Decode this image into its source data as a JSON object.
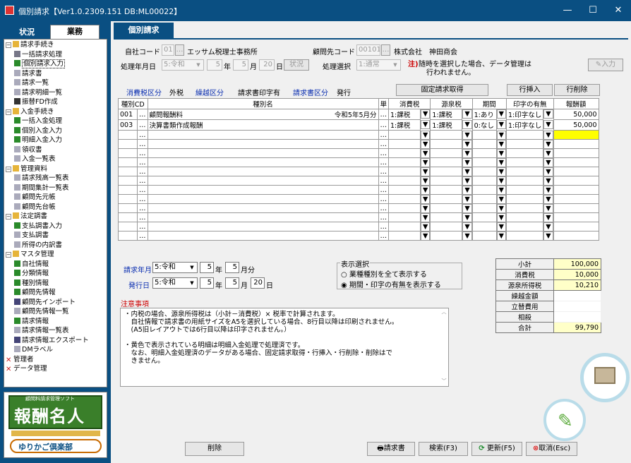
{
  "window": {
    "title": "個別請求【Ver1.0.2309.151 DB:ML00022】",
    "minimize": "—",
    "maximize": "☐",
    "close": "✕"
  },
  "sidebar": {
    "tab_status": "状況",
    "tab_business": "業務",
    "tree": [
      {
        "label": "請求手続き",
        "level": 0,
        "box": "−",
        "icon": "folder"
      },
      {
        "label": "一括請求処理",
        "level": 1,
        "icon": "list"
      },
      {
        "label": "個別請求入力",
        "level": 1,
        "icon": "pen",
        "selected": true
      },
      {
        "label": "請求書",
        "level": 1,
        "icon": "doc"
      },
      {
        "label": "請求一覧",
        "level": 1,
        "icon": "doc"
      },
      {
        "label": "請求明細一覧",
        "level": 1,
        "icon": "doc"
      },
      {
        "label": "振替FD作成",
        "level": 1,
        "icon": "disk"
      },
      {
        "label": "入金手続き",
        "level": 0,
        "box": "−",
        "icon": "folder"
      },
      {
        "label": "一括入金処理",
        "level": 1,
        "icon": "pen"
      },
      {
        "label": "個別入金入力",
        "level": 1,
        "icon": "pen"
      },
      {
        "label": "明細入金入力",
        "level": 1,
        "icon": "pen"
      },
      {
        "label": "領収書",
        "level": 1,
        "icon": "doc"
      },
      {
        "label": "入金一覧表",
        "level": 1,
        "icon": "doc"
      },
      {
        "label": "管理資料",
        "level": 0,
        "box": "−",
        "icon": "folder"
      },
      {
        "label": "請求残高一覧表",
        "level": 1,
        "icon": "doc"
      },
      {
        "label": "期間集計一覧表",
        "level": 1,
        "icon": "doc"
      },
      {
        "label": "顧問先元帳",
        "level": 1,
        "icon": "doc"
      },
      {
        "label": "顧問先台帳",
        "level": 1,
        "icon": "doc"
      },
      {
        "label": "法定調書",
        "level": 0,
        "box": "−",
        "icon": "folder"
      },
      {
        "label": "支払調書入力",
        "level": 1,
        "icon": "pen"
      },
      {
        "label": "支払調書",
        "level": 1,
        "icon": "doc"
      },
      {
        "label": "所得の内訳書",
        "level": 1,
        "icon": "doc"
      },
      {
        "label": "マスタ管理",
        "level": 0,
        "box": "−",
        "icon": "folder"
      },
      {
        "label": "自社情報",
        "level": 1,
        "icon": "pen"
      },
      {
        "label": "分類情報",
        "level": 1,
        "icon": "pen"
      },
      {
        "label": "種別情報",
        "level": 1,
        "icon": "pen"
      },
      {
        "label": "顧問先情報",
        "level": 1,
        "icon": "pen"
      },
      {
        "label": "顧問先インポート",
        "level": 1,
        "icon": "import"
      },
      {
        "label": "顧問先情報一覧",
        "level": 1,
        "icon": "doc"
      },
      {
        "label": "請求情報",
        "level": 1,
        "icon": "pen"
      },
      {
        "label": "請求情報一覧表",
        "level": 1,
        "icon": "doc"
      },
      {
        "label": "請求情報エクスポート",
        "level": 1,
        "icon": "import"
      },
      {
        "label": "DMラベル",
        "level": 1,
        "icon": "doc"
      },
      {
        "label": "管理者",
        "level": 0,
        "icon": "x"
      },
      {
        "label": "データ管理",
        "level": 0,
        "icon": "x"
      }
    ],
    "logo": {
      "small": "顧問料請求管理ソフト",
      "big": "報酬名人",
      "brand": "ゆりかご倶楽部"
    }
  },
  "main": {
    "tab": "個別請求",
    "company_label": "自社コード",
    "company_code": "01",
    "company_name": "エッサム税理士事務所",
    "client_label": "顧問先コード",
    "client_code": "00101",
    "client_name": "株式会社　神田商会",
    "date_label": "処理年月日",
    "era": "5:令和",
    "year": "5",
    "year_unit": "年",
    "month": "5",
    "month_unit": "月",
    "day": "20",
    "day_unit": "日",
    "status_btn": "状況",
    "proc_label": "処理選択",
    "proc_value": "1:通常",
    "note_mark": "注)",
    "note_text1": "随時を選択した場合、データ管理は",
    "note_text2": "行われません。",
    "input_btn": "入力",
    "tax_label": "消費税区分",
    "tax_value": "外税",
    "carry_label": "繰越区分",
    "carry_value": "請求書印字有",
    "bill_label": "請求書区分",
    "bill_value": "発行",
    "fixed_btn": "固定請求取得",
    "insert_btn": "行挿入",
    "delete_row_btn": "行削除",
    "grid": {
      "headers": [
        "種別CD",
        "種別名",
        "単",
        "消費税",
        "源泉税",
        "期間",
        "印字の有無",
        "報酬額"
      ],
      "rows": [
        {
          "cd": "001",
          "name": "顧問報酬料",
          "period": "令和5年5月分",
          "tax": "1:課税",
          "wh": "1:課税",
          "term": "1:あり",
          "print": "1:印字なし",
          "amount": "50,000"
        },
        {
          "cd": "003",
          "name": "決算書類作成報酬",
          "period": "",
          "tax": "1:課税",
          "wh": "1:課税",
          "term": "0:なし",
          "print": "1:印字なし",
          "amount": "50,000"
        }
      ],
      "empty_rows": 12
    },
    "billym_label": "請求年月",
    "bill_era": "5:令和",
    "bill_year": "5",
    "bill_month": "5",
    "bill_suffix": "月分",
    "issue_label": "発行日",
    "issue_era": "5:令和",
    "issue_year": "5",
    "issue_month": "5",
    "issue_day": "20",
    "display_title": "表示選択",
    "display_opt1": "業種種別を全て表示する",
    "display_opt2": "期間・印字の有無を表示する",
    "summary": [
      {
        "k": "小計",
        "v": "100,000"
      },
      {
        "k": "消費税",
        "v": "10,000"
      },
      {
        "k": "源泉所得税",
        "v": "10,210"
      },
      {
        "k": "繰越金額",
        "v": ""
      },
      {
        "k": "立替費用",
        "v": ""
      },
      {
        "k": "相殺",
        "v": ""
      },
      {
        "k": "合計",
        "v": "99,790"
      }
    ],
    "notes_title": "注意事項",
    "notes": [
      "・内税の場合、源泉所得税は（小計－消費税）× 税率で計算されます。",
      "　自社情報で請求書の用紙サイズをA5を選択している場合、8行目以降は印刷されません。",
      "　(A5旧レイアウトでは6行目以降は印字されません。）",
      "",
      "・黄色で表示されている明細は明細入金処理で処理済です。",
      "　なお、明細入金処理済のデータがある場合、固定請求取得・行挿入・行削除・削除はで",
      "　きません。"
    ],
    "btn_delete": "削除",
    "btn_invoice": "請求書",
    "btn_search": "検索(F3)",
    "btn_update": "更新(F5)",
    "btn_cancel": "取消(Esc)"
  }
}
